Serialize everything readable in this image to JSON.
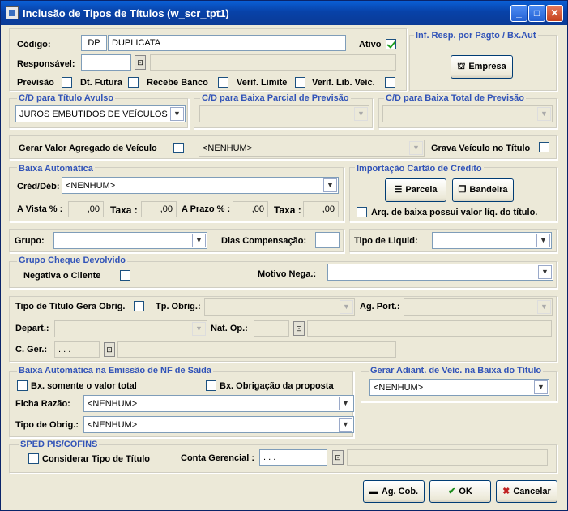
{
  "window": {
    "title": "Inclusão de Tipos de Títulos (w_scr_tpt1)",
    "min": "_",
    "max": "□",
    "close": "✕"
  },
  "codigo": {
    "label": "Código:",
    "code": "DP",
    "name": "DUPLICATA"
  },
  "ativo": {
    "label": "Ativo",
    "checked": true
  },
  "responsavel": {
    "label": "Responsável:",
    "value": "",
    "desc": ""
  },
  "flags": {
    "previsao": "Previsão",
    "dt_futura": "Dt. Futura",
    "recebe_banco": "Recebe Banco",
    "verif_limite": "Verif. Limite",
    "verif_lib_veic": "Verif. Lib. Veíc."
  },
  "inf_resp": {
    "title": "Inf. Resp. por Pagto / Bx.Aut",
    "empresa": "Empresa"
  },
  "cd_avulso": {
    "title": "C/D para Título Avulso",
    "value": "JUROS EMBUTIDOS DE VEÍCULOS"
  },
  "cd_parcial": {
    "title": "C/D para Baixa Parcial de Previsão",
    "value": ""
  },
  "cd_total": {
    "title": "C/D para Baixa Total de Previsão",
    "value": ""
  },
  "valor_agregado": {
    "label": "Gerar Valor Agregado de Veículo",
    "value": "<NENHUM>"
  },
  "grava_veiculo": {
    "label": "Grava Veículo no Título"
  },
  "baixa_auto": {
    "title": "Baixa Automática",
    "cred_deb_label": "Créd/Déb:",
    "cred_deb": "<NENHUM>",
    "avista_label": "A Vista % :",
    "avista": ",00",
    "taxa1_label": "Taxa :",
    "taxa1": ",00",
    "aprazo_label": "A Prazo % :",
    "aprazo": ",00",
    "taxa2_label": "Taxa :",
    "taxa2": ",00"
  },
  "importacao": {
    "title": "Importação Cartão de Crédito",
    "parcela": "Parcela",
    "bandeira": "Bandeira",
    "arq_baixa": "Arq. de baixa possui valor líq. do título."
  },
  "grupo": {
    "label": "Grupo:",
    "value": ""
  },
  "dias_comp": {
    "label": "Dias Compensação:",
    "value": ""
  },
  "tipo_liquid": {
    "label": "Tipo de Liquid:",
    "value": ""
  },
  "cheque_dev": {
    "title": "Grupo Cheque Devolvido",
    "negativa": "Negativa o Cliente",
    "motivo_label": "Motivo Nega.:",
    "motivo": ""
  },
  "obrig": {
    "tipo_titulo_label": "Tipo de Título Gera Obrig.",
    "tp_obrig_label": "Tp. Obrig.:",
    "ag_port_label": "Ag. Port.:",
    "depart_label": "Depart.:",
    "nat_op_label": "Nat. Op.:",
    "cger_label": "C. Ger.:",
    "cger_value": ". . ."
  },
  "nf_saida": {
    "title": "Baixa Automática na Emissão de NF de Saída",
    "bx_valor_total": "Bx. somente o valor total",
    "bx_obrigacao": "Bx. Obrigação da proposta",
    "ficha_label": "Ficha Razão:",
    "ficha": "<NENHUM>",
    "tipo_obrig_label": "Tipo de Obrig.:",
    "tipo_obrig": "<NENHUM>"
  },
  "adiant": {
    "title": "Gerar Adiant. de Veíc. na Baixa do Título",
    "value": "<NENHUM>"
  },
  "sped": {
    "title": "SPED PIS/COFINS",
    "considerar": "Considerar Tipo de Título",
    "conta_label": "Conta Gerencial :",
    "conta_value": ". . .",
    "conta_desc": ""
  },
  "footer": {
    "ag_cob": "Ag. Cob.",
    "ok": "OK",
    "cancelar": "Cancelar"
  }
}
